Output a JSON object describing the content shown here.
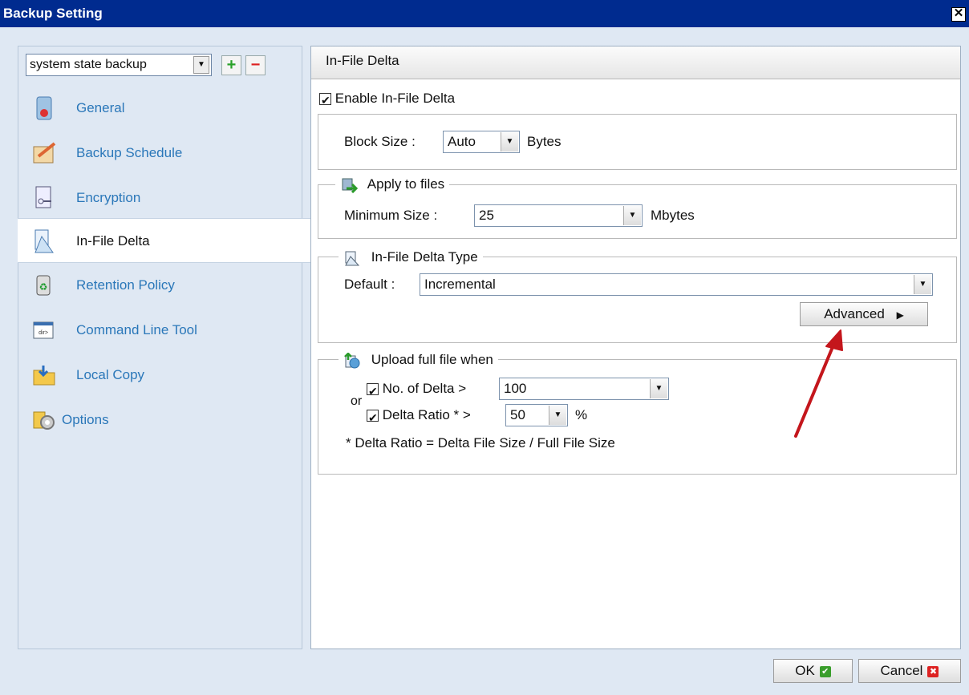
{
  "window": {
    "title": "Backup Setting",
    "close_label": "✕"
  },
  "backup_set": {
    "selected": "system state backup"
  },
  "nav": {
    "items": [
      {
        "label": "General",
        "icon": "general-icon"
      },
      {
        "label": "Backup Schedule",
        "icon": "schedule-icon"
      },
      {
        "label": "Encryption",
        "icon": "encryption-icon"
      },
      {
        "label": "In-File Delta",
        "icon": "delta-icon"
      },
      {
        "label": "Retention Policy",
        "icon": "recycle-icon"
      },
      {
        "label": "Command Line Tool",
        "icon": "command-line-icon"
      },
      {
        "label": "Local Copy",
        "icon": "folder-icon"
      },
      {
        "label": "Options",
        "icon": "options-icon"
      }
    ],
    "active": "In-File Delta"
  },
  "panel": {
    "title": "In-File Delta",
    "enable_label": "Enable In-File Delta",
    "block_size": {
      "label": "Block Size :",
      "value": "Auto",
      "unit": "Bytes"
    },
    "apply_files": {
      "legend": "Apply to files",
      "min_label": "Minimum Size :",
      "min_value": "25",
      "unit": "Mbytes"
    },
    "delta_type": {
      "legend": "In-File Delta Type",
      "default_label": "Default :",
      "value": "Incremental",
      "advanced_label": "Advanced"
    },
    "upload": {
      "legend": "Upload full file when",
      "no_delta_label": "No. of Delta >",
      "no_delta_value": "100",
      "or_label": "or",
      "ratio_label": "Delta Ratio * >",
      "ratio_value": "50",
      "ratio_unit": "%",
      "note": "* Delta Ratio = Delta File Size / Full File Size"
    }
  },
  "footer": {
    "ok_label": "OK",
    "cancel_label": "Cancel"
  },
  "colors": {
    "titlebar": "#002b8f",
    "nav_link": "#2a77b9",
    "arrow": "#c4161c"
  }
}
